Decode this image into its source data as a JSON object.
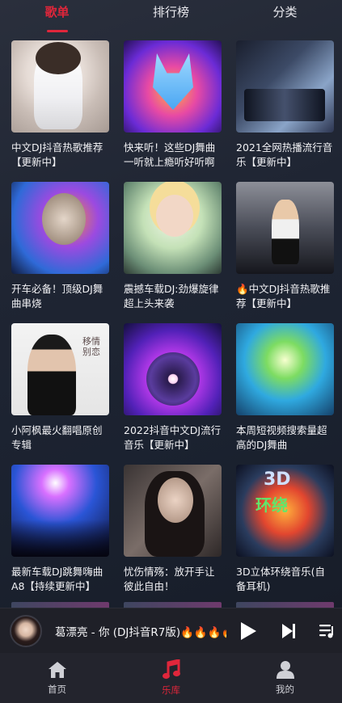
{
  "tabs": [
    {
      "label": "歌单",
      "active": true
    },
    {
      "label": "排行榜",
      "active": false
    },
    {
      "label": "分类",
      "active": false
    }
  ],
  "playlists": [
    {
      "title": "中文DJ抖音热歌推荐【更新中】",
      "cover": "cover-woman-white-dress"
    },
    {
      "title": "快来听！这些DJ舞曲一听就上瘾听好听啊",
      "cover": "cover-neon-wolf"
    },
    {
      "title": "2021全网热播流行音乐【更新中】",
      "cover": "cover-dj-deck"
    },
    {
      "title": "开车必备！顶级DJ舞曲串烧",
      "cover": "cover-dj-man"
    },
    {
      "title": "震撼车载DJ:劲爆旋律超上头来袭",
      "cover": "cover-dj-girl-headphones"
    },
    {
      "title": "🔥中文DJ抖音热歌推荐【更新中】",
      "cover": "cover-dj-girl-stage"
    },
    {
      "title": "小阿枫最火翻唱原创专辑",
      "cover": "cover-singer-portrait"
    },
    {
      "title": "2022抖音中文DJ流行音乐【更新中】",
      "cover": "cover-turntable"
    },
    {
      "title": "本周短视频搜索量超高的DJ舞曲",
      "cover": "cover-color-splash"
    },
    {
      "title": "最新车载DJ跳舞嗨曲A8【持续更新中】",
      "cover": "cover-club-crowd"
    },
    {
      "title": "忧伤情殇：放开手让彼此自由！",
      "cover": "cover-sad-girl"
    },
    {
      "title": "3D立体环绕音乐(自备耳机)",
      "cover": "cover-3d-vinyl"
    }
  ],
  "cover_text": {
    "item6_side": "移情 别恋",
    "item11_top": "3D",
    "item11_mid": "环绕"
  },
  "player": {
    "song": "葛漂亮 - 你 (DJ抖音R7版)🔥🔥🔥🔥",
    "play_icon": "play-icon",
    "next_icon": "next-icon",
    "playlist_icon": "playlist-icon"
  },
  "nav": [
    {
      "label": "首页",
      "icon": "home-icon",
      "active": false
    },
    {
      "label": "乐库",
      "icon": "music-note-icon",
      "active": true
    },
    {
      "label": "我的",
      "icon": "user-icon",
      "active": false
    }
  ],
  "colors": {
    "accent": "#e0263b",
    "background": "#1f2533",
    "player_bg": "#1f2028",
    "nav_bg": "#23242d"
  }
}
